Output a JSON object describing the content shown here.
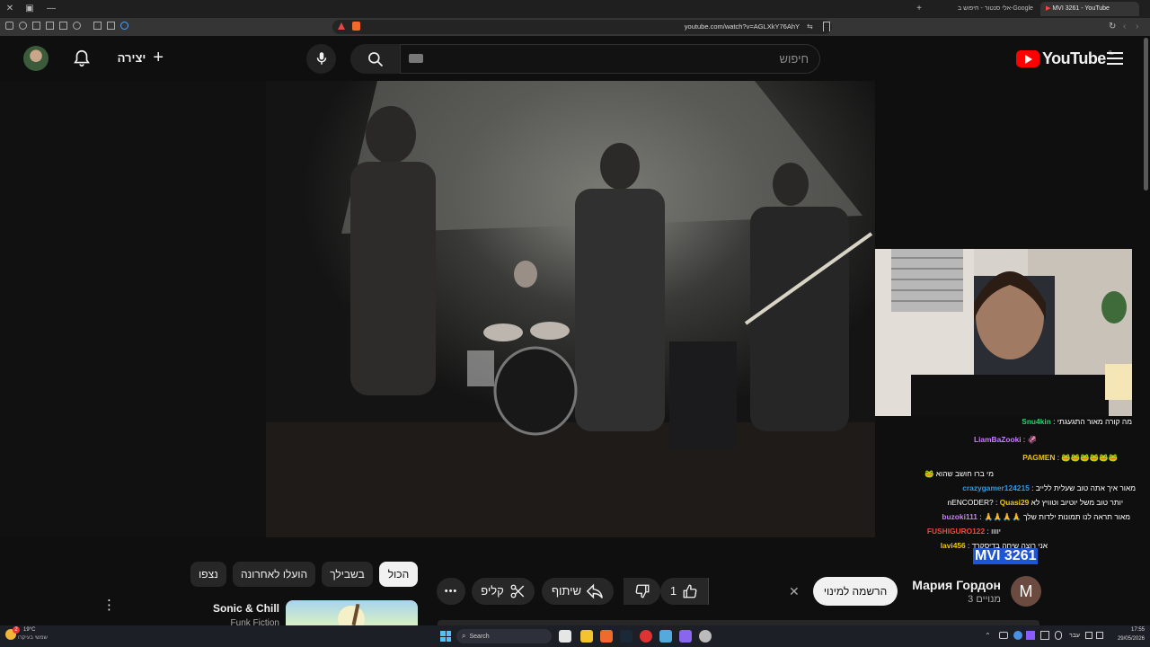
{
  "browser": {
    "tabs": [
      {
        "label": "אלי סנטור - חיפוש ב-Google"
      },
      {
        "label": "MVI 3261 - YouTube"
      }
    ],
    "url": "youtube.com/watch?v=AGLXkY76AhY"
  },
  "header": {
    "logo_text": "YouTube",
    "region": "IL",
    "search_placeholder": "חיפוש",
    "create_label": "יצירה"
  },
  "chat": [
    {
      "user": "Snu4kin",
      "sep": ":",
      "text": "מה קורה מאור התגעגתי",
      "color": "#2ecc71"
    },
    {
      "user": "LiamBaZooki",
      "sep": ":",
      "text": "🦑",
      "color": "#c77dff"
    },
    {
      "user": "PAGMEN",
      "sep": ":",
      "text": "🐸🐸🐸🐸🐸🐸",
      "color": "#f1c40f"
    },
    {
      "user": "",
      "sep": "",
      "text": "מי ברו חושב שהוא 🐸",
      "color": "#ffffff"
    },
    {
      "user": "crazygamer124215",
      "sep": ":",
      "text": "מאור איך אתה טוב שעלית ללייב",
      "color": "#3498db"
    },
    {
      "user": "Quasi29",
      "sep": ":",
      "text": "יותר טוב משל יוטיוב וטוויץ לא nENCODER?",
      "color": "#f1c40f"
    },
    {
      "user": "buzoki111",
      "sep": ":",
      "text": "מאור תראה לנו תמונות ילדות שלך 🙏🙏🙏🙏",
      "color": "#c77dff"
    },
    {
      "user": "FUSHIGURO122",
      "sep": ":",
      "text": "יוווו",
      "color": "#e74c3c"
    },
    {
      "user": "lavi456",
      "sep": ":",
      "text": "אני רוצה שיחה בדיסקרד",
      "color": "#f1c40f"
    }
  ],
  "video": {
    "title": "MVI 3261",
    "channel": "Мария Гордон",
    "subscribers": "3 מנויים",
    "channel_initial": "M",
    "subscribe_label": "הרשמה למינוי",
    "like_count": "1",
    "share_label": "שיתוף",
    "clip_label": "קליפ",
    "more_label": "•••"
  },
  "filters": {
    "chips": [
      "הכול",
      "בשבילך",
      "הועלו לאחרונה",
      "נצפו"
    ],
    "selected": "הכול"
  },
  "recommendation": {
    "title": "Sonic & Chill",
    "channel": "Funk Fiction"
  },
  "taskbar": {
    "weather_temp": "19°C",
    "weather_text": "שמשי בעיקרו",
    "search_label": "Search",
    "time": "17:55",
    "date": "29/05/2026",
    "lang": "עבר",
    "notif_count": "2"
  },
  "colors": {
    "yt_red": "#ff0000",
    "background": "#0f0f0f",
    "subscribe_bg": "#f1f1f1",
    "highlight": "#1a56d6"
  }
}
